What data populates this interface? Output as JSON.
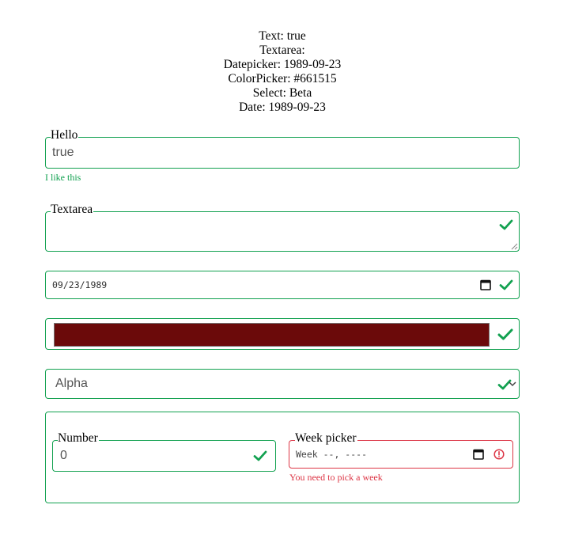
{
  "summary": {
    "text": "Text: true",
    "textarea": "Textarea:",
    "datepicker": "Datepicker: 1989-09-23",
    "colorpicker": "ColorPicker: #661515",
    "select": "Select: Beta",
    "date": "Date: 1989-09-23"
  },
  "text_field": {
    "legend": "Hello",
    "value": "true",
    "help": "I like this"
  },
  "textarea_field": {
    "legend": "Textarea",
    "value": ""
  },
  "date_field": {
    "value": "09/23/1989"
  },
  "color_field": {
    "value": "#6b0a0a"
  },
  "select_field": {
    "selected": "Alpha"
  },
  "number_field": {
    "legend": "Number",
    "value": "0"
  },
  "week_field": {
    "legend": "Week picker",
    "placeholder": "Week --, ----",
    "error": "You need to pick a week"
  },
  "colors": {
    "valid": "#12a150",
    "invalid": "#dc3545"
  },
  "icons": {
    "valid": "check-icon",
    "invalid": "alert-circle-icon",
    "calendar": "calendar-icon",
    "dropdown": "chevron-down-icon"
  }
}
